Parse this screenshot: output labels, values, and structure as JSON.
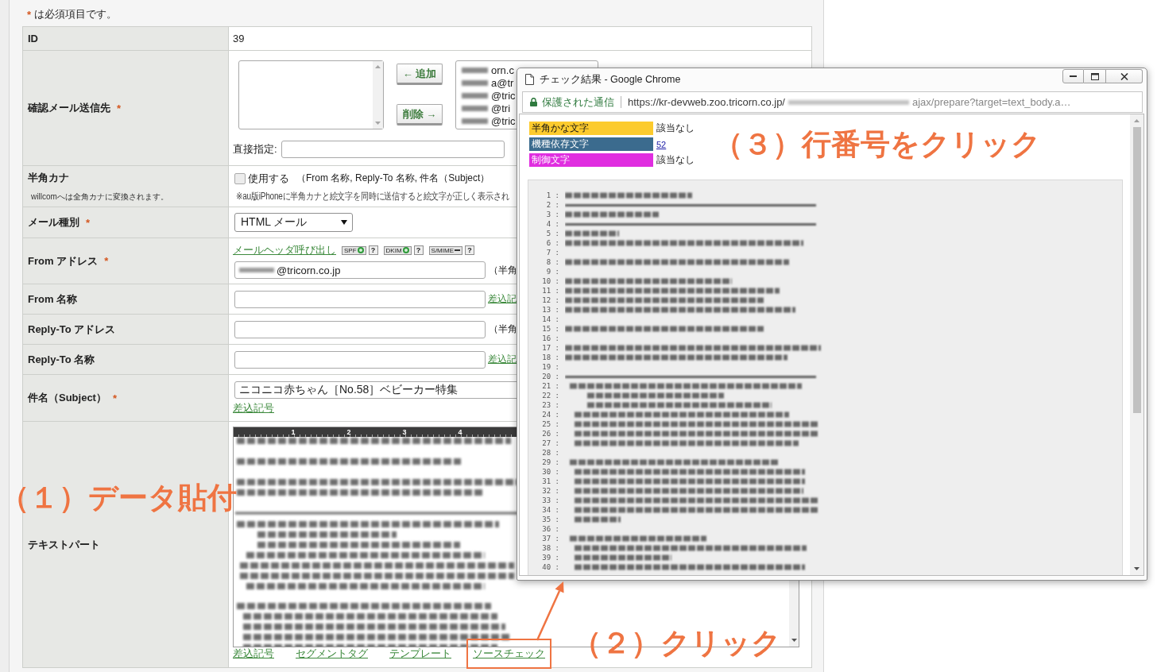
{
  "required_note": {
    "mark": "*",
    "text": "は必須項目です。"
  },
  "form": {
    "rows": [
      {
        "kind": "text",
        "label": "ID",
        "value": "39"
      },
      {
        "kind": "recipients",
        "label": "確認メール送信先",
        "required_mark": "*",
        "add_button": "← 追加",
        "remove_button": "削除 →",
        "selected_addresses": [
          "orn.c",
          "a@tr",
          "@tric",
          "@tri",
          "@tric"
        ],
        "direct_label": "直接指定:"
      },
      {
        "kind": "checkbox",
        "label": "半角カナ",
        "note": "willcomへは全角カナに変換されます。",
        "checkbox": {
          "label": "使用する",
          "checked": false
        },
        "scope": "（From 名称, Reply-To 名称, 件名（Subject）",
        "warning": "※au版iPhoneに半角カナと絵文字を同時に送信すると絵文字が正しく表示され"
      },
      {
        "kind": "select",
        "label": "メール種別",
        "required_mark": "*",
        "value": "HTML メール"
      },
      {
        "kind": "from_address",
        "label": "From アドレス",
        "required_mark": "*",
        "header_link": "メールヘッダ呼び出し",
        "badges": [
          {
            "label": "SPF",
            "verified": true,
            "help": "?"
          },
          {
            "label": "DKIM",
            "verified": true,
            "help": "?"
          },
          {
            "label": "S/MIME",
            "verified": false,
            "help": "?"
          }
        ],
        "value": "@tricorn.co.jp",
        "hint": "（半角"
      },
      {
        "kind": "input",
        "label": "From 名称",
        "link": "差込記"
      },
      {
        "kind": "input",
        "label": "Reply-To アドレス",
        "hint": "（半角"
      },
      {
        "kind": "input",
        "label": "Reply-To 名称",
        "link": "差込記"
      },
      {
        "kind": "subject",
        "label": "件名（Subject）",
        "required_mark": "*",
        "value": "ニコニコ赤ちゃん［No.58］ベビーカー特集",
        "link": "差込記号"
      },
      {
        "kind": "editor",
        "label": "テキストパート",
        "ruler_marks": [
          "1",
          "2",
          "3",
          "4"
        ],
        "links": [
          {
            "label": "差込記号",
            "highlighted": false
          },
          {
            "label": "セグメントタグ",
            "highlighted": false
          },
          {
            "label": "テンプレート",
            "highlighted": false
          },
          {
            "label": "ソースチェック",
            "highlighted": true
          }
        ]
      }
    ]
  },
  "popup": {
    "title": "チェック結果 - Google Chrome",
    "security_label": "保護された通信",
    "url_host": "https://kr-devweb.zoo.tricorn.co.jp/",
    "url_path": "ajax/prepare?target=text_body.a…",
    "legend": [
      {
        "label": "半角かな文字",
        "color": "#fccb2e",
        "kind": "text",
        "result": "該当なし"
      },
      {
        "label": "機種依存文字",
        "color": "#3b6b8e",
        "kind": "link",
        "result": "52"
      },
      {
        "label": "制御文字",
        "color": "#e02ee0",
        "kind": "text",
        "result": "該当なし"
      }
    ],
    "line_numbers": [
      "1 :",
      "2 :",
      "3 :",
      "4 :",
      "5 :",
      "6 :",
      "7 :",
      "8 :",
      "9 :",
      "10 :",
      "11 :",
      "12 :",
      "13 :",
      "14 :",
      "15 :",
      "16 :",
      "17 :",
      "18 :",
      "19 :",
      "20 :",
      "21 :",
      "22 :",
      "23 :",
      "24 :",
      "25 :",
      "26 :",
      "27 :",
      "28 :",
      "29 :",
      "30 :",
      "31 :",
      "32 :",
      "33 :",
      "34 :",
      "35 :",
      "36 :",
      "37 :",
      "38 :",
      "39 :",
      "40 :"
    ]
  },
  "annotations": [
    {
      "text": "（１）データ貼付"
    },
    {
      "text": "（２）クリック"
    },
    {
      "text": "（３）行番号をクリック"
    }
  ]
}
